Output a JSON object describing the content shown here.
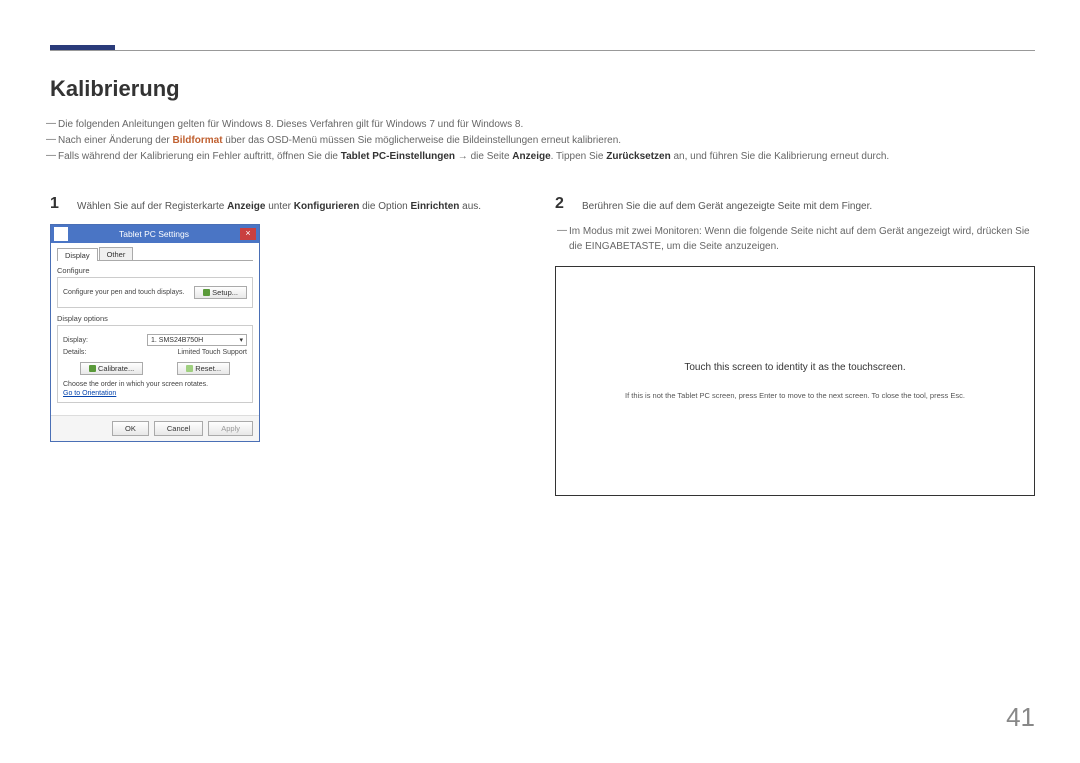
{
  "header": {
    "title": "Kalibrierung"
  },
  "intro": {
    "line1": "Die folgenden Anleitungen gelten für Windows 8. Dieses Verfahren gilt für Windows 7 und für Windows 8.",
    "line2_pre": "Nach einer Änderung der ",
    "line2_bold": "Bildformat",
    "line2_post": " über das OSD-Menü müssen Sie möglicherweise die Bildeinstellungen erneut kalibrieren.",
    "line3_pre": "Falls während der Kalibrierung ein Fehler auftritt, öffnen Sie die ",
    "line3_b1": "Tablet PC-Einstellungen",
    "line3_mid": " → die Seite ",
    "line3_b2": "Anzeige",
    "line3_mid2": ". Tippen Sie ",
    "line3_b3": "Zurücksetzen",
    "line3_post": " an, und führen Sie die Kalibrierung erneut durch."
  },
  "step1": {
    "num": "1",
    "pre": "Wählen Sie auf der Registerkarte ",
    "b1": "Anzeige",
    "mid1": " unter ",
    "b2": "Konfigurieren",
    "mid2": " die Option ",
    "b3": "Einrichten",
    "post": " aus."
  },
  "dialog": {
    "title": "Tablet PC Settings",
    "close": "×",
    "tab_display": "Display",
    "tab_other": "Other",
    "configure_label": "Configure",
    "configure_text": "Configure your pen and touch displays.",
    "setup_btn": "Setup...",
    "display_options_label": "Display options",
    "display_label": "Display:",
    "display_value": "1. SMS24B750H",
    "details_label": "Details:",
    "details_value": "Limited Touch Support",
    "calibrate_btn": "Calibrate...",
    "reset_btn": "Reset...",
    "rotation_text": "Choose the order in which your screen rotates.",
    "orientation_link": "Go to Orientation",
    "ok": "OK",
    "cancel": "Cancel",
    "apply": "Apply"
  },
  "step2": {
    "num": "2",
    "text": "Berühren Sie die auf dem Gerät angezeigte Seite mit dem Finger.",
    "sub": "Im Modus mit zwei Monitoren: Wenn die folgende Seite nicht auf dem Gerät angezeigt wird, drücken Sie die EINGABETASTE, um die Seite anzuzeigen."
  },
  "touch_screen": {
    "main": "Touch this screen to identity it as the touchscreen.",
    "sub": "If this is not the Tablet PC screen, press Enter to move to the next screen. To close the tool, press Esc."
  },
  "page_number": "41"
}
